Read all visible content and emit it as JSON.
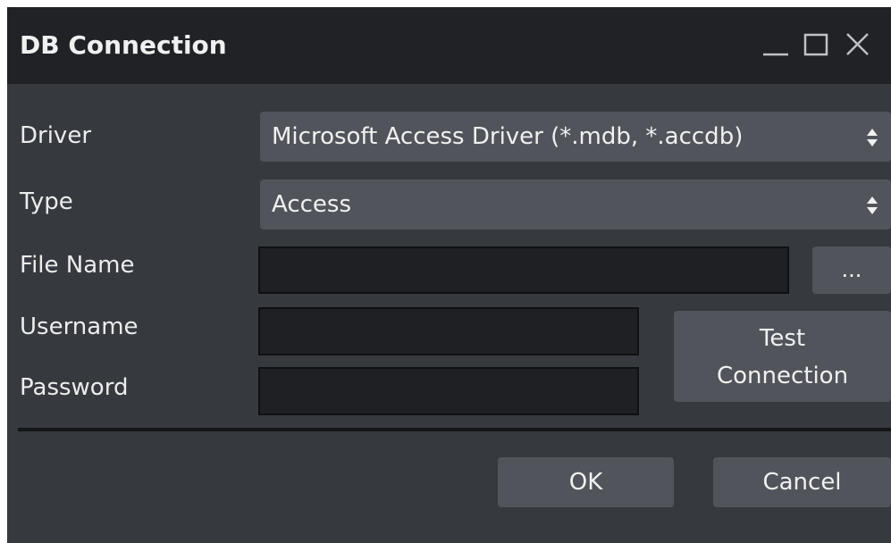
{
  "window": {
    "title": "DB Connection",
    "controls": {
      "minimize": "minimize-icon",
      "maximize": "maximize-icon",
      "close": "close-icon"
    }
  },
  "form": {
    "driver": {
      "label": "Driver",
      "value": "Microsoft Access Driver (*.mdb, *.accdb)"
    },
    "type": {
      "label": "Type",
      "value": "Access"
    },
    "file_name": {
      "label": "File Name",
      "value": "",
      "browse_label": "..."
    },
    "username": {
      "label": "Username",
      "value": ""
    },
    "password": {
      "label": "Password",
      "value": ""
    }
  },
  "buttons": {
    "test_connection_line1": "Test",
    "test_connection_line2": "Connection",
    "ok": "OK",
    "cancel": "Cancel"
  },
  "colors": {
    "title_bar": "#202226",
    "window_bg": "#36393e",
    "control_bg": "#51555b",
    "field_bg": "#1e2024",
    "text": "#f0f0f0"
  }
}
